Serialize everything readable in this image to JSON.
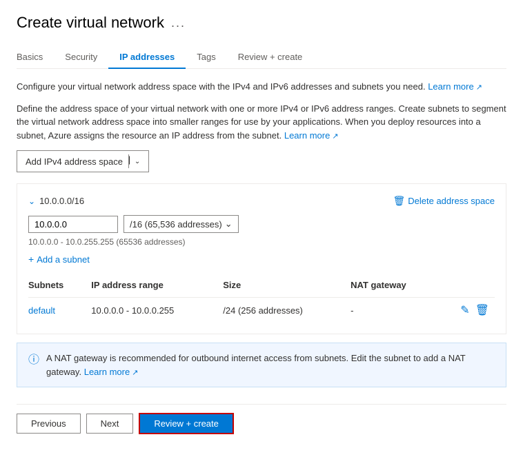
{
  "header": {
    "title": "Create virtual network",
    "ellipsis_label": "..."
  },
  "tabs": [
    {
      "id": "basics",
      "label": "Basics",
      "active": false
    },
    {
      "id": "security",
      "label": "Security",
      "active": false
    },
    {
      "id": "ip-addresses",
      "label": "IP addresses",
      "active": true
    },
    {
      "id": "tags",
      "label": "Tags",
      "active": false
    },
    {
      "id": "review-create",
      "label": "Review + create",
      "active": false
    }
  ],
  "descriptions": {
    "line1_before": "Configure your virtual network address space with the IPv4 and IPv6 addresses and subnets you need.",
    "line1_link_text": "Learn more",
    "line2": "Define the address space of your virtual network with one or more IPv4 or IPv6 address ranges. Create subnets to segment the virtual network address space into smaller ranges for use by your applications. When you deploy resources into a subnet, Azure assigns the resource an IP address from the subnet.",
    "line2_link_text": "Learn more"
  },
  "add_button": {
    "label": "Add IPv4 address space",
    "divider": "|"
  },
  "address_space": {
    "title": "10.0.0.0/16",
    "ip_value": "10.0.0.0",
    "cidr_value": "/16 (65,536 addresses)",
    "range_text": "10.0.0.0 - 10.0.255.255 (65536 addresses)",
    "delete_label": "Delete address space"
  },
  "add_subnet": {
    "label": "Add a subnet"
  },
  "table": {
    "headers": [
      "Subnets",
      "IP address range",
      "Size",
      "NAT gateway"
    ],
    "rows": [
      {
        "subnet": "default",
        "ip_range": "10.0.0.0 - 10.0.0.255",
        "size": "/24 (256 addresses)",
        "nat_gateway": "-"
      }
    ]
  },
  "nat_warning": {
    "text": "A NAT gateway is recommended for outbound internet access from subnets. Edit the subnet to add a NAT gateway.",
    "link_text": "Learn more"
  },
  "footer": {
    "previous_label": "Previous",
    "next_label": "Next",
    "review_create_label": "Review + create"
  },
  "icons": {
    "collapse": "⌄",
    "delete_trash": "🗑",
    "delete_document": "📄",
    "plus": "+",
    "info": "ℹ",
    "edit": "✏",
    "trash": "🗑",
    "chevron_down": "∨"
  }
}
